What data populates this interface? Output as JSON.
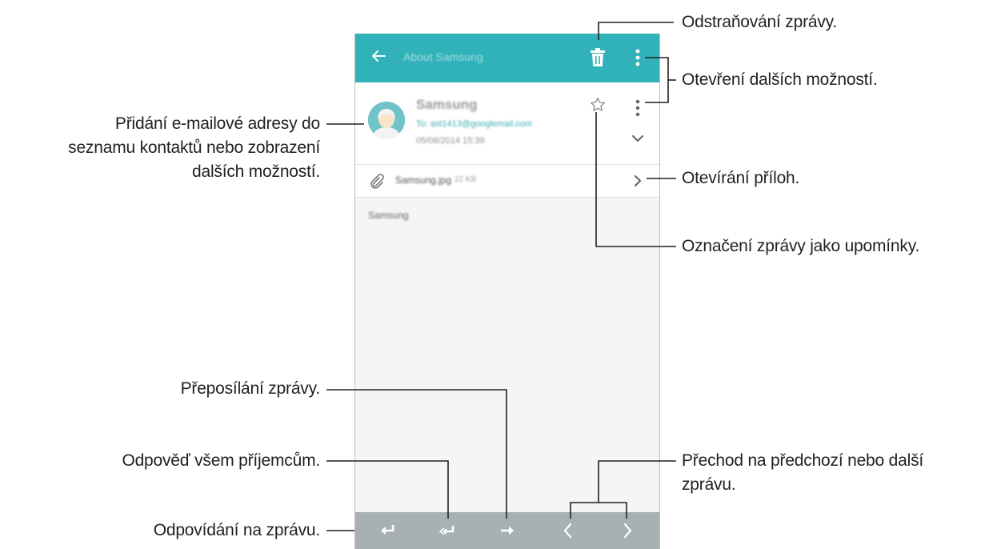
{
  "app": {
    "title": "About Samsung",
    "accent_color": "#31b1b9",
    "bottom_bar_color": "#a7b0b3"
  },
  "message": {
    "sender": "Samsung",
    "to": "To: ast1413@googlemail.com",
    "date": "05/08/2014 15:39",
    "attachment_name": "Samsung.jpg",
    "attachment_size": "22 KB",
    "body": "Samsung"
  },
  "icons": {
    "back": "back-arrow-icon",
    "delete": "trash-icon",
    "more": "more-vertical-icon",
    "avatar": "contact-avatar-icon",
    "star": "star-icon",
    "expand": "chevron-down-icon",
    "attachment": "paperclip-icon",
    "open_attachment": "chevron-right-icon",
    "reply": "reply-icon",
    "reply_all": "reply-all-icon",
    "forward": "forward-icon",
    "previous": "chevron-left-icon",
    "next": "chevron-right-icon"
  },
  "callouts": {
    "delete": "Odstraňování zprávy.",
    "more_options": "Otevření dalších možností.",
    "add_contact_line1": "Přidání e-mailové adresy do",
    "add_contact_line2": "seznamu kontaktů nebo zobrazení",
    "add_contact_line3": "dalších možností.",
    "open_attachments": "Otevírání příloh.",
    "mark_reminder": "Označení zprávy jako upomínky.",
    "forward": "Přeposílání zprávy.",
    "reply_all": "Odpověď všem příjemcům.",
    "prev_next_line1": "Přechod na předchozí nebo další",
    "prev_next_line2": "zprávu.",
    "reply": "Odpovídání na zprávu."
  }
}
